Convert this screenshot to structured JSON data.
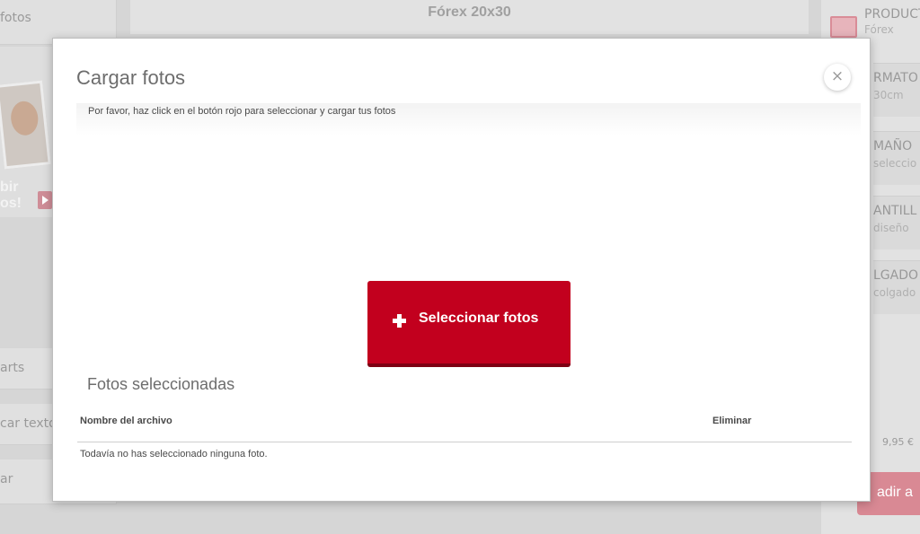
{
  "background": {
    "left": {
      "card1_text": "fotos",
      "promo_text_line1": "bir",
      "promo_text_line2": "os!",
      "card2_text": "arts",
      "card3_text": "car texto",
      "card4_text": "ar"
    },
    "center_title": "Fórex 20x30",
    "right": {
      "product_label": "PRODUCT",
      "product_value": "Fórex",
      "format_label": "RMATO",
      "format_value": "30cm",
      "size_label": "MAÑO",
      "size_value": "seleccio",
      "template_label": "ANTILL",
      "template_value": "diseño",
      "hanging_label": "LGADO",
      "hanging_value": "colgado",
      "price": "9,95 €",
      "add_button": "adir a"
    }
  },
  "modal": {
    "title": "Cargar fotos",
    "close_symbol": "×",
    "instructions": "Por favor, haz click en el botón rojo para seleccionar y cargar tus fotos",
    "select_button": "Seleccionar fotos",
    "section_title": "Fotos seleccionadas",
    "table": {
      "columns": [
        "Nombre del archivo",
        "Eliminar"
      ],
      "empty_message": "Todavía no has seleccionado ninguna foto."
    }
  },
  "colors": {
    "accent_red": "#c2001e",
    "accent_red_dark": "#7e0013"
  }
}
